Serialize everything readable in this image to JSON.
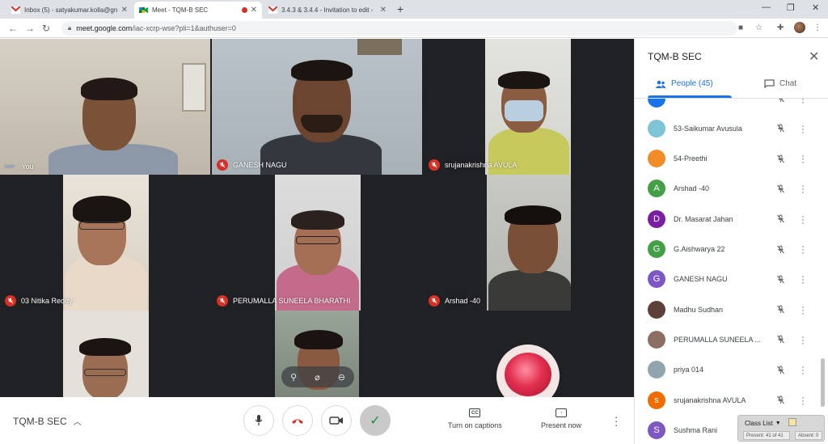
{
  "browser": {
    "tabs": [
      {
        "title": "Inbox (5) - satyakumar.kolla@gn",
        "favicon": "gmail-icon"
      },
      {
        "title": "Meet - TQM-B SEC",
        "favicon": "meet-icon",
        "recording": true
      },
      {
        "title": "3.4.3 & 3.4.4 - Invitation to edit -",
        "favicon": "gmail-icon"
      }
    ],
    "url_domain": "meet.google.com",
    "url_path": "/iac-xcrp-wse?pli=1&authuser=0"
  },
  "tiles": [
    {
      "name": "You",
      "self": true
    },
    {
      "name": "GANESH NAGU",
      "muted": true
    },
    {
      "name": "srujanakrishna AVULA",
      "muted": true
    },
    {
      "name": "03 Nitika Reddy",
      "muted": true
    },
    {
      "name": "PERUMALLA SUNEELA BHARATHI",
      "muted": true
    },
    {
      "name": "Arshad -40",
      "muted": true
    },
    {
      "name": ""
    },
    {
      "name": ""
    },
    {
      "name": ""
    }
  ],
  "controls": {
    "meeting_name": "TQM-B SEC",
    "captions_label": "Turn on captions",
    "captions_icon_text": "CC",
    "present_label": "Present now"
  },
  "panel": {
    "title": "TQM-B SEC",
    "people_tab": "People (45)",
    "chat_tab": "Chat",
    "people": [
      {
        "name": "",
        "initial": "",
        "color": "#1a73e8"
      },
      {
        "name": "53-Saikumar Avusula",
        "initial": "",
        "color": "#7cc4d6"
      },
      {
        "name": "54-Preethi",
        "initial": "",
        "color": "#f28c28"
      },
      {
        "name": "Arshad -40",
        "initial": "A",
        "color": "#43a047"
      },
      {
        "name": "Dr. Masarat Jahan",
        "initial": "D",
        "color": "#7b1fa2"
      },
      {
        "name": "G.Aishwarya 22",
        "initial": "G",
        "color": "#43a047"
      },
      {
        "name": "GANESH NAGU",
        "initial": "G",
        "color": "#7e57c2"
      },
      {
        "name": "Madhu Sudhan",
        "initial": "",
        "color": "#5d4037"
      },
      {
        "name": "PERUMALLA SUNEELA ...",
        "initial": "",
        "color": "#8d6e63"
      },
      {
        "name": "priya 014",
        "initial": "",
        "color": "#90a4ae"
      },
      {
        "name": "srujanakrishna AVULA",
        "initial": "s",
        "color": "#ef6c00"
      },
      {
        "name": "Sushma Rani",
        "initial": "S",
        "color": "#7e57c2"
      }
    ]
  },
  "class_list": {
    "title": "Class List",
    "present": "Present: 41 of 41",
    "absent": "Absent: 0"
  }
}
